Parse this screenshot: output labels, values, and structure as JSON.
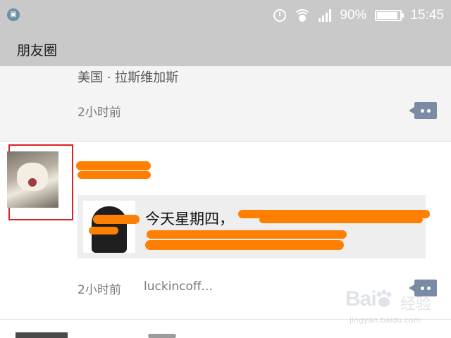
{
  "status_bar": {
    "notification_icon": "screenshot-icon",
    "battery_percent": "90%",
    "battery_level": 0.9,
    "time": "15:45",
    "icons": [
      "alarm-icon",
      "wifi-icon",
      "signal-icon",
      "battery-icon"
    ]
  },
  "header": {
    "title": "朋友圈"
  },
  "feed": {
    "post1": {
      "location": "美国 · 拉斯维加斯",
      "time": "2小时前"
    },
    "post2": {
      "shared_text": "今天星期四，",
      "time": "2小时前",
      "source": "luckincoff..."
    }
  },
  "colors": {
    "status_bar_bg": "#c9c9c9",
    "redaction": "#ff7f00",
    "highlight_frame": "#e02020",
    "comment_button": "#7a8ba3"
  },
  "watermark": {
    "logo": "Bai",
    "text": "经验",
    "url": "jingyan.baidu.com"
  }
}
